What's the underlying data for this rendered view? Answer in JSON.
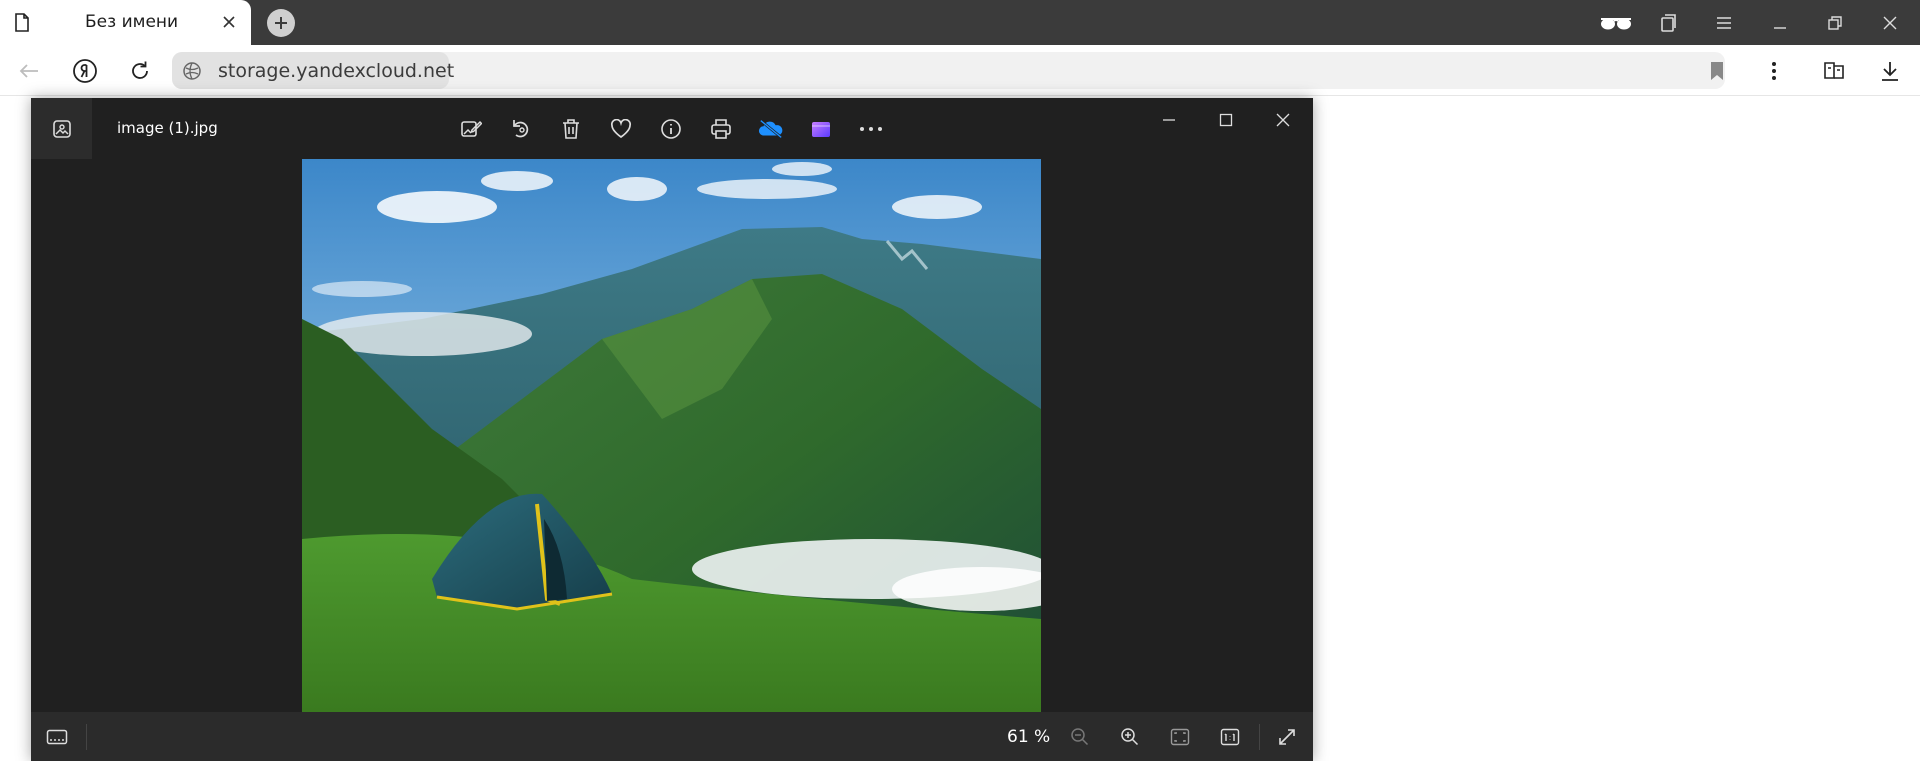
{
  "browser": {
    "tab": {
      "title": "Без имени"
    },
    "address": {
      "url": "storage.yandexcloud.net"
    }
  },
  "photos": {
    "file_name": "image (1).jpg",
    "zoom": "61 %",
    "toolbar": [
      "edit-image",
      "rotate",
      "delete",
      "favorite",
      "info",
      "print",
      "onedrive",
      "clipchamp",
      "more"
    ]
  },
  "colors": {
    "tab_strip": "#3b3b3b",
    "viewer_bg": "#202020",
    "viewer_bottom": "#2b2b2b",
    "onedrive_blue": "#1e90ff",
    "clipchamp_purple": "#8a4bff"
  }
}
